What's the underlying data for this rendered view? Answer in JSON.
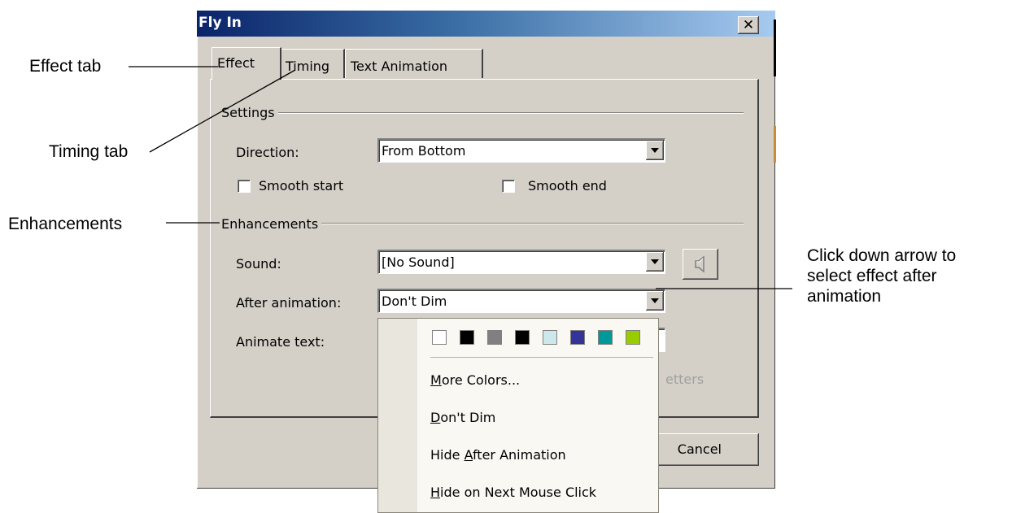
{
  "dialog": {
    "title": "Fly In",
    "close_label": "✕",
    "tabs": [
      {
        "label": "Effect"
      },
      {
        "label": "Timing"
      },
      {
        "label": "Text Animation"
      }
    ],
    "settings": {
      "group_label": "Settings",
      "direction_label": "Direction:",
      "direction_value": "From Bottom",
      "smooth_start_label": "Smooth start",
      "smooth_end_label": "Smooth end"
    },
    "enhancements": {
      "group_label": "Enhancements",
      "sound_label": "Sound:",
      "sound_value": "[No Sound]",
      "after_label": "After animation:",
      "after_value": "Don't Dim",
      "animate_label": "Animate text:",
      "partial_letters": "etters"
    },
    "cancel_label": "Cancel"
  },
  "dropdown": {
    "swatches": [
      "#ffffff",
      "#000000",
      "#808080",
      "#000000",
      "#cce8ea",
      "#33339a",
      "#009999",
      "#99cc00"
    ],
    "items": [
      {
        "pre": "",
        "accel": "M",
        "post": "ore Colors..."
      },
      {
        "pre": "",
        "accel": "D",
        "post": "on't Dim"
      },
      {
        "pre": "Hide ",
        "accel": "A",
        "post": "fter Animation"
      },
      {
        "pre": "",
        "accel": "H",
        "post": "ide on Next Mouse Click"
      }
    ]
  },
  "annotations": {
    "effect_tab": "Effect tab",
    "timing_tab": "Timing tab",
    "enhancements": "Enhancements",
    "down_arrow_line1": "Click down arrow to",
    "down_arrow_line2": "select effect after",
    "down_arrow_line3": "animation"
  }
}
